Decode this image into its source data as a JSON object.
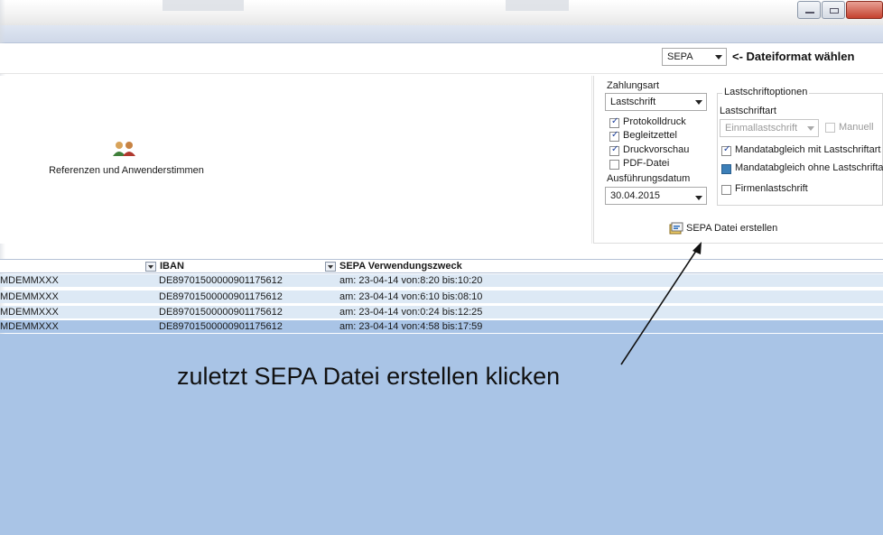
{
  "toolbar": {
    "format_select_value": "SEPA",
    "format_hint": "<- Dateiformat wählen"
  },
  "references": {
    "label": "Referenzen und Anwenderstimmen",
    "icon": "people-icon"
  },
  "sepa": {
    "zahlungsart_label": "Zahlungsart",
    "zahlungsart_value": "Lastschrift",
    "options": [
      {
        "label": "Protokolldruck",
        "checked": true
      },
      {
        "label": "Begleitzettel",
        "checked": true
      },
      {
        "label": "Druckvorschau",
        "checked": true
      },
      {
        "label": "PDF-Datei",
        "checked": false
      }
    ],
    "ausfuehrungsdatum_label": "Ausführungsdatum",
    "ausfuehrungsdatum_value": "30.04.2015",
    "lastschriftoptionen_title": "Lastschriftoptionen",
    "lastschriftart_label": "Lastschriftart",
    "lastschriftart_value": "Einmallastschrift",
    "manuell_label": "Manuell",
    "mandat_mit_label": "Mandatabgleich mit Lastschriftart",
    "mandat_ohne_label": "Mandatabgleich ohne Lastschriftart",
    "firmen_label": "Firmenlastschrift",
    "create_button_label": "SEPA Datei erstellen",
    "create_button_icon": "sepa-file-icon"
  },
  "grid": {
    "columns": [
      "IBAN",
      "SEPA Verwendungszweck"
    ],
    "rows": [
      {
        "bic": "MDEMMXXX",
        "iban": "DE89701500000901175612",
        "zweck": "am: 23-04-14 von:8:20 bis:10:20"
      },
      {
        "bic": "MDEMMXXX",
        "iban": "DE89701500000901175612",
        "zweck": "am: 23-04-14 von:6:10 bis:08:10"
      },
      {
        "bic": "MDEMMXXX",
        "iban": "DE89701500000901175612",
        "zweck": "am: 23-04-14 von:0:24 bis:12:25"
      },
      {
        "bic": "MDEMMXXX",
        "iban": "DE89701500000901175612",
        "zweck": "am: 23-04-14 von:4:58 bis:17:59"
      }
    ],
    "row_colors": [
      "#dde9f5",
      "#dde9f5",
      "#dde9f5",
      "#a9c4e6"
    ]
  },
  "annotation": {
    "text": "zuletzt SEPA Datei erstellen klicken"
  },
  "colors": {
    "selection_blue": "#a9c4e6",
    "row_light": "#dde9f5",
    "close_red": "#c4412f"
  }
}
